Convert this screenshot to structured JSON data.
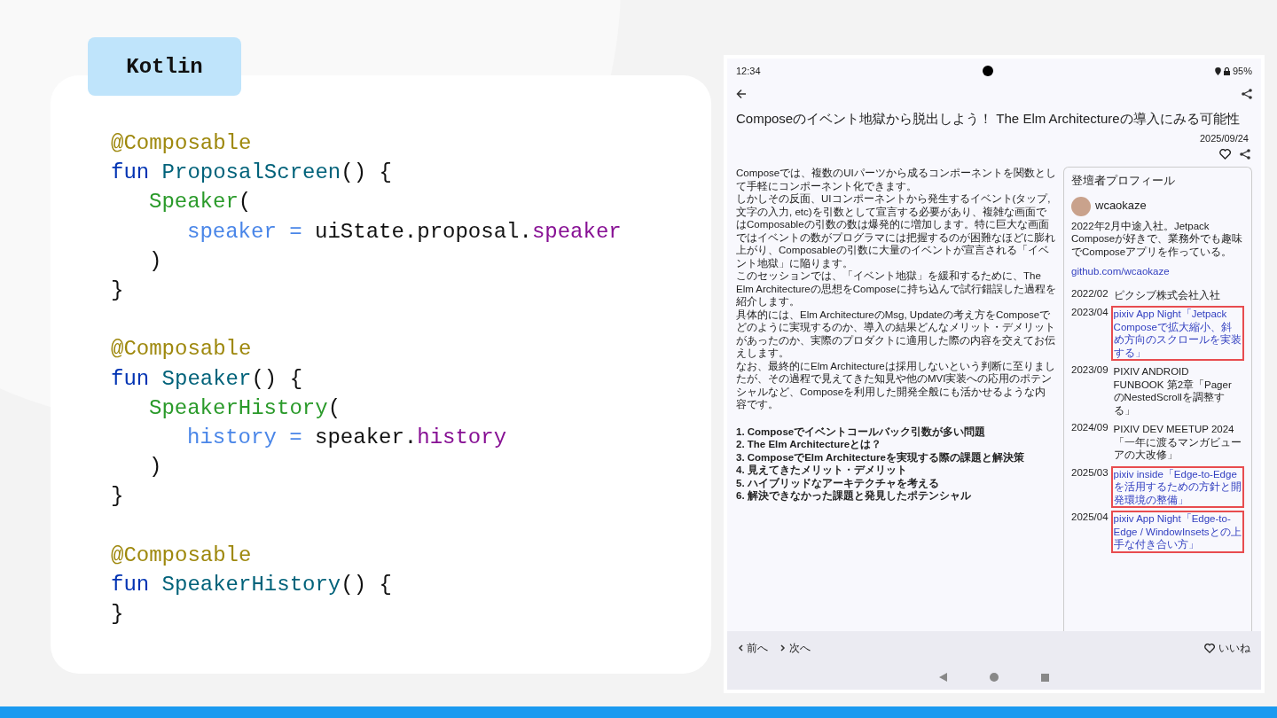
{
  "code_panel": {
    "language_tab": "Kotlin",
    "blocks": [
      [
        {
          "tokens": [
            {
              "kind": "annotation",
              "text": "@Composable"
            }
          ]
        },
        {
          "tokens": [
            {
              "kind": "keyword",
              "text": "fun "
            },
            {
              "kind": "function",
              "text": "ProposalScreen"
            },
            {
              "kind": "plain",
              "text": "() {"
            }
          ],
          "children": [
            {
              "tokens": [
                {
                  "kind": "call",
                  "text": "Speaker"
                },
                {
                  "kind": "plain",
                  "text": "("
                }
              ],
              "children": [
                {
                  "tokens": [
                    {
                      "kind": "param",
                      "text": "speaker = "
                    },
                    {
                      "kind": "plain",
                      "text": "uiState.proposal."
                    },
                    {
                      "kind": "property",
                      "text": "speaker"
                    }
                  ]
                }
              ]
            },
            {
              "tokens": [
                {
                  "kind": "plain",
                  "text": ")"
                }
              ]
            }
          ]
        },
        {
          "tokens": [
            {
              "kind": "plain",
              "text": "}"
            }
          ]
        }
      ],
      [
        {
          "tokens": [
            {
              "kind": "annotation",
              "text": "@Composable"
            }
          ]
        },
        {
          "tokens": [
            {
              "kind": "keyword",
              "text": "fun "
            },
            {
              "kind": "function",
              "text": "Speaker"
            },
            {
              "kind": "plain",
              "text": "() {"
            }
          ],
          "children": [
            {
              "tokens": [
                {
                  "kind": "call",
                  "text": "SpeakerHistory"
                },
                {
                  "kind": "plain",
                  "text": "("
                }
              ],
              "children": [
                {
                  "tokens": [
                    {
                      "kind": "param",
                      "text": "history = "
                    },
                    {
                      "kind": "plain",
                      "text": "speaker."
                    },
                    {
                      "kind": "property",
                      "text": "history"
                    }
                  ]
                }
              ]
            },
            {
              "tokens": [
                {
                  "kind": "plain",
                  "text": ")"
                }
              ]
            }
          ]
        },
        {
          "tokens": [
            {
              "kind": "plain",
              "text": "}"
            }
          ]
        }
      ],
      [
        {
          "tokens": [
            {
              "kind": "annotation",
              "text": "@Composable"
            }
          ]
        },
        {
          "tokens": [
            {
              "kind": "keyword",
              "text": "fun "
            },
            {
              "kind": "function",
              "text": "SpeakerHistory"
            },
            {
              "kind": "plain",
              "text": "() {"
            }
          ]
        },
        {
          "tokens": [
            {
              "kind": "plain",
              "text": "}"
            }
          ]
        }
      ]
    ]
  },
  "phone": {
    "status_bar": {
      "time": "12:34",
      "battery": "95%"
    },
    "title": "Composeのイベント地獄から脱出しよう！ The Elm Architectureの導入にみる可能性",
    "date": "2025/09/24",
    "description": [
      "Composeでは、複数のUIパーツから成るコンポーネントを関数として手軽にコンポーネント化できます。",
      "しかしその反面、UIコンポーネントから発生するイベント(タップ, 文字の入力, etc)を引数として宣言する必要があり、複雑な画面ではComposableの引数の数は爆発的に増加します。特に巨大な画面ではイベントの数がプログラマには把握するのが困難なほどに膨れ上がり、Composableの引数に大量のイベントが宣言される「イベント地獄」に陥ります。",
      "このセッションでは、「イベント地獄」を緩和するために、The Elm Architectureの思想をComposeに持ち込んで試行錯誤した過程を紹介します。",
      "具体的には、Elm ArchitectureのMsg, Updateの考え方をComposeでどのように実現するのか、導入の結果どんなメリット・デメリットがあったのか、実際のプロダクトに適用した際の内容を交えてお伝えします。",
      "なお、最終的にElm Architectureは採用しないという判断に至りましたが、その過程で見えてきた知見や他のMVI実装への応用のポテンシャルなど、Composeを利用した開発全般にも活かせるような内容です。"
    ],
    "agenda": [
      "1. Composeでイベントコールバック引数が多い問題",
      "2. The Elm Architectureとは？",
      "3. ComposeでElm Architectureを実現する際の課題と解決策",
      "4. 見えてきたメリット・デメリット",
      "5. ハイブリッドなアーキテクチャを考える",
      "6. 解決できなかった課題と発見したポテンシャル"
    ],
    "profile": {
      "heading": "登壇者プロフィール",
      "name": "wcaokaze",
      "bio": "2022年2月中途入社。Jetpack Composeが好きで、業務外でも趣味でComposeアプリを作っている。",
      "link": "github.com/wcaokaze",
      "history": [
        {
          "date": "2022/02",
          "text": "ピクシブ株式会社入社",
          "highlighted": false
        },
        {
          "date": "2023/04",
          "text": "pixiv App Night「Jetpack Composeで拡大縮小、斜め方向のスクロールを実装する」",
          "highlighted": true
        },
        {
          "date": "2023/09",
          "text": "PIXIV ANDROID FUNBOOK 第2章「PagerのNestedScrollを調整する」",
          "highlighted": false
        },
        {
          "date": "2024/09",
          "text": "PIXIV DEV MEETUP 2024「一年に渡るマンガビューアの大改修」",
          "highlighted": false
        },
        {
          "date": "2025/03",
          "text": "pixiv inside「Edge-to-Edgeを活用するための方針と開発環境の整備」",
          "highlighted": true
        },
        {
          "date": "2025/04",
          "text": "pixiv App Night「Edge-to-Edge / WindowInsetsとの上手な付き合い方」",
          "highlighted": true
        }
      ]
    },
    "bottom_bar": {
      "prev": "前へ",
      "next": "次へ",
      "like": "いいね"
    }
  }
}
